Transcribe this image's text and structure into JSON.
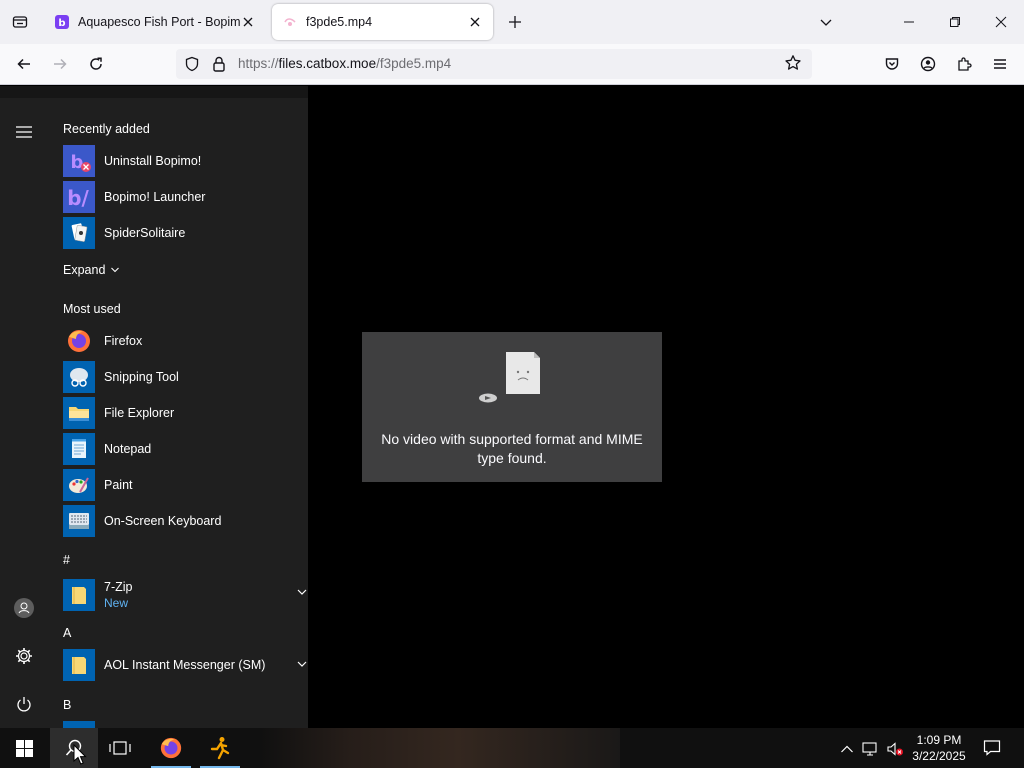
{
  "browser": {
    "tabs": [
      {
        "title": "Aquapesco Fish Port - Bopimo!",
        "favicon": "bopimo-icon",
        "active": false
      },
      {
        "title": "f3pde5.mp4",
        "favicon": "video-icon",
        "active": true
      }
    ],
    "url": {
      "scheme": "https://",
      "host": "files.catbox.moe",
      "path": "/f3pde5.mp4"
    }
  },
  "video": {
    "error_message": "No video with supported format and MIME type found.",
    "error_icon": "sad-file-icon"
  },
  "start_menu": {
    "recently_added_label": "Recently added",
    "recently_added": [
      {
        "label": "Uninstall Bopimo!",
        "icon": "bopimo-uninstall-icon"
      },
      {
        "label": "Bopimo! Launcher",
        "icon": "bopimo-icon"
      },
      {
        "label": "SpiderSolitaire",
        "icon": "spider-solitaire-icon"
      }
    ],
    "expand_label": "Expand",
    "most_used_label": "Most used",
    "most_used": [
      {
        "label": "Firefox",
        "icon": "firefox-icon"
      },
      {
        "label": "Snipping Tool",
        "icon": "snipping-tool-icon"
      },
      {
        "label": "File Explorer",
        "icon": "folder-icon"
      },
      {
        "label": "Notepad",
        "icon": "notepad-icon"
      },
      {
        "label": "Paint",
        "icon": "paint-icon"
      },
      {
        "label": "On-Screen Keyboard",
        "icon": "keyboard-icon"
      }
    ],
    "groups": [
      {
        "letter": "#",
        "items": [
          {
            "label": "7-Zip",
            "sub": "New",
            "icon": "folder-icon"
          }
        ]
      },
      {
        "letter": "A",
        "items": [
          {
            "label": "AOL Instant Messenger (SM)",
            "icon": "folder-icon"
          }
        ]
      },
      {
        "letter": "B",
        "items": []
      }
    ]
  },
  "taskbar": {
    "pinned": [
      "start-icon",
      "search-icon",
      "task-view-icon",
      "firefox-icon",
      "runner-app-icon"
    ],
    "tray": [
      "chevron-up-icon",
      "network-icon",
      "volume-muted-icon"
    ],
    "time": "1:09 PM",
    "date": "3/22/2025",
    "notification_icon": "action-center-icon"
  }
}
